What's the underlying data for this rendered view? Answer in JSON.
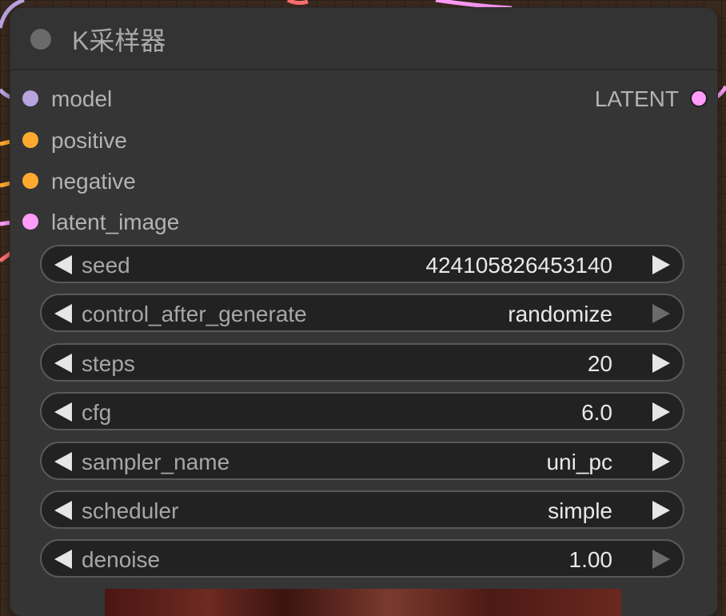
{
  "node": {
    "title": "K采样器"
  },
  "inputs": [
    {
      "label": "model",
      "color": "#b9a4e0"
    },
    {
      "label": "positive",
      "color": "#ffa931"
    },
    {
      "label": "negative",
      "color": "#ffa931"
    },
    {
      "label": "latent_image",
      "color": "#ff9cf9"
    }
  ],
  "outputs": [
    {
      "label": "LATENT",
      "color": "#ff9cf9"
    }
  ],
  "widgets": [
    {
      "label": "seed",
      "value": "424105826453140"
    },
    {
      "label": "control_after_generate",
      "value": "randomize"
    },
    {
      "label": "steps",
      "value": "20"
    },
    {
      "label": "cfg",
      "value": "6.0"
    },
    {
      "label": "sampler_name",
      "value": "uni_pc"
    },
    {
      "label": "scheduler",
      "value": "simple"
    },
    {
      "label": "denoise",
      "value": "1.00"
    }
  ],
  "link_colors": {
    "model": "#b9a4e0",
    "conditioning": "#ffa931",
    "latent": "#ff9cf9",
    "other": "#ff6f6f"
  }
}
